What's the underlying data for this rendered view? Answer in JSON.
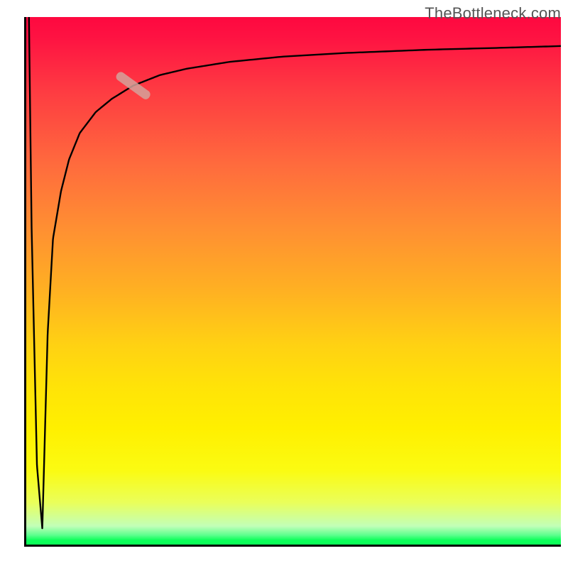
{
  "watermark": "TheBottleneck.com",
  "chart_data": {
    "type": "line",
    "title": "",
    "xlabel": "",
    "ylabel": "",
    "xlim": [
      0,
      100
    ],
    "ylim": [
      0,
      100
    ],
    "series": [
      {
        "name": "curve",
        "x": [
          0.5,
          1,
          2,
          3,
          4,
          5,
          6.5,
          8,
          10,
          13,
          16,
          20,
          25,
          30,
          38,
          48,
          60,
          75,
          90,
          100
        ],
        "values": [
          100,
          60,
          15,
          3,
          40,
          58,
          67,
          73,
          78,
          82,
          84.5,
          87,
          89,
          90.2,
          91.5,
          92.5,
          93.2,
          93.8,
          94.2,
          94.5
        ]
      }
    ],
    "annotation_marker": {
      "x": 20,
      "y": 87,
      "length_pct": 6
    },
    "gradient": {
      "stops": [
        {
          "pct": 0,
          "color": "#fe0840"
        },
        {
          "pct": 14,
          "color": "#fe3b42"
        },
        {
          "pct": 40,
          "color": "#ff8f32"
        },
        {
          "pct": 62,
          "color": "#ffd113"
        },
        {
          "pct": 78,
          "color": "#fff000"
        },
        {
          "pct": 92,
          "color": "#eaff5a"
        },
        {
          "pct": 98.2,
          "color": "#5dff8e"
        },
        {
          "pct": 100,
          "color": "#0bff58"
        }
      ]
    },
    "axes_visible": {
      "left": true,
      "bottom": true,
      "right": false,
      "top": false
    },
    "grid": false,
    "legend": false
  }
}
